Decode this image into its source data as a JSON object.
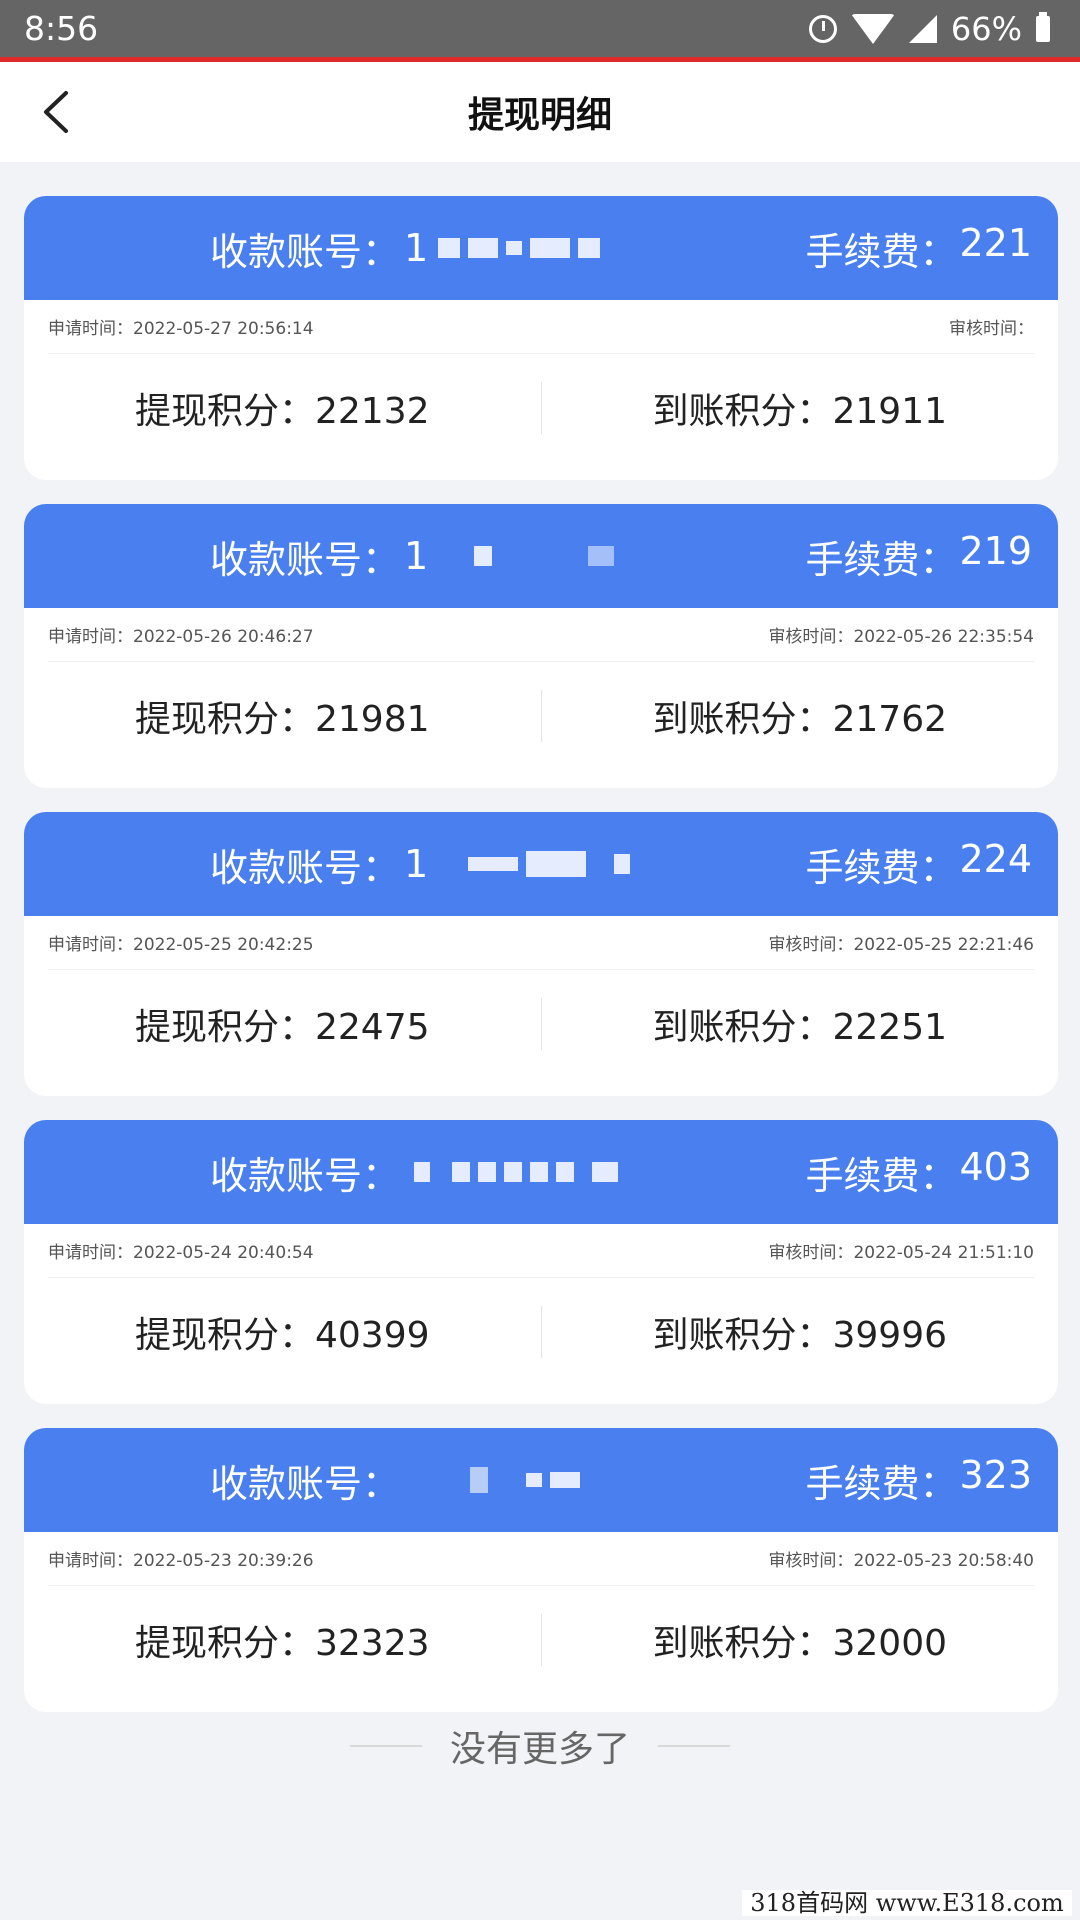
{
  "status_bar": {
    "time": "8:56",
    "battery": "66%"
  },
  "nav": {
    "title": "提现明细"
  },
  "labels": {
    "account": "收款账号：",
    "fee": "手续费：",
    "apply_time": "申请时间：",
    "review_time": "审核时间：",
    "withdraw_points": "提现积分：",
    "received_points": "到账积分："
  },
  "records": [
    {
      "account_visible": "1",
      "fee": "221",
      "apply_time": "2022-05-27 20:56:14",
      "review_time": "",
      "withdraw_points": "22132",
      "received_points": "21911"
    },
    {
      "account_visible": "1",
      "fee": "219",
      "apply_time": "2022-05-26 20:46:27",
      "review_time": "2022-05-26 22:35:54",
      "withdraw_points": "21981",
      "received_points": "21762"
    },
    {
      "account_visible": "1",
      "fee": "224",
      "apply_time": "2022-05-25 20:42:25",
      "review_time": "2022-05-25 22:21:46",
      "withdraw_points": "22475",
      "received_points": "22251"
    },
    {
      "account_visible": "",
      "fee": "403",
      "apply_time": "2022-05-24 20:40:54",
      "review_time": "2022-05-24 21:51:10",
      "withdraw_points": "40399",
      "received_points": "39996"
    },
    {
      "account_visible": "",
      "fee": "323",
      "apply_time": "2022-05-23 20:39:26",
      "review_time": "2022-05-23 20:58:40",
      "withdraw_points": "32323",
      "received_points": "32000"
    }
  ],
  "footer": {
    "no_more": "没有更多了"
  },
  "watermark": "318首码网 www.E318.com",
  "colors": {
    "header_blue": "#4a7ff0",
    "accent_red": "#e02a2a"
  }
}
